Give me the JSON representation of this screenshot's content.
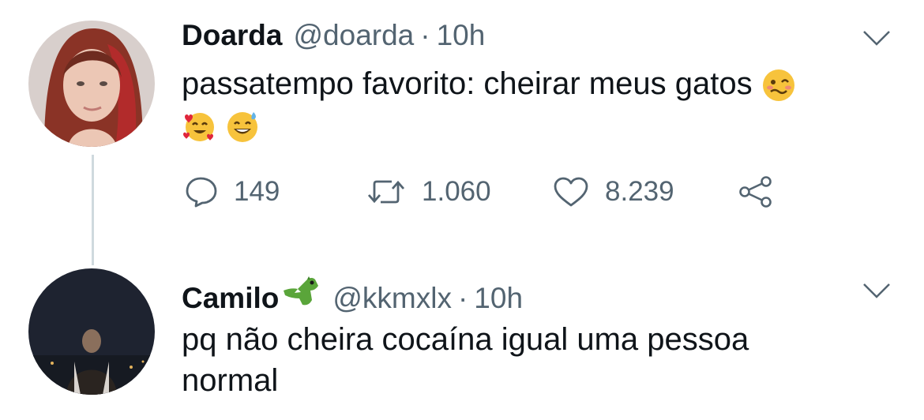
{
  "tweets": [
    {
      "name": "Doarda",
      "handle": "@doarda",
      "separator": "·",
      "time": "10h",
      "text": "passatempo favorito: cheirar meus gatos",
      "replies": "149",
      "retweets": "1.060",
      "likes": "8.239"
    },
    {
      "name": "Camilo",
      "handle": "@kkmxlx",
      "separator": "·",
      "time": "10h",
      "text_line1": "pq não cheira cocaína igual uma pessoa",
      "text_line2": "normal"
    }
  ],
  "colors": {
    "text_primary": "#0f1419",
    "text_secondary": "#536471",
    "thread_line": "#cfd9de",
    "emoji_yellow": "#f7c33c"
  },
  "icons": [
    "reply-icon",
    "retweet-icon",
    "like-icon",
    "share-icon",
    "chevron-down-icon",
    "woozy-face-emoji",
    "smiling-face-with-hearts-emoji",
    "grinning-sweat-emoji",
    "crocodile-emoji"
  ]
}
